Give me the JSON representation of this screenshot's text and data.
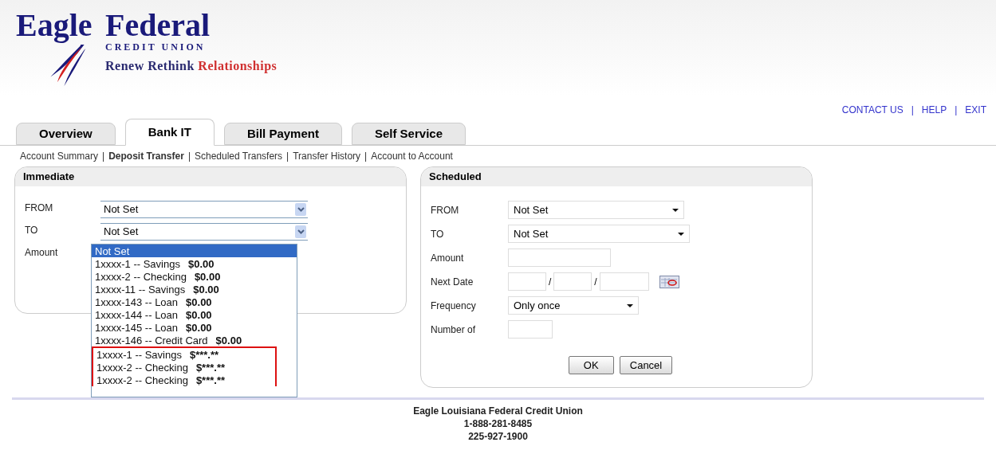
{
  "logo": {
    "word_1": "Eagle",
    "word_2": "Federal",
    "subtitle": "CREDIT UNION",
    "tagline": "Renew Rethink **Relationships**"
  },
  "top_links": [
    "CONTACT US",
    "HELP",
    "EXIT"
  ],
  "top_link_separators": [
    "|",
    "|"
  ],
  "tabs": [
    {
      "label": "Overview",
      "selected": false
    },
    {
      "label": "Bank IT",
      "selected": true
    },
    {
      "label": "Bill Payment",
      "selected": false
    },
    {
      "label": "Self Service",
      "selected": false
    }
  ],
  "subnav": [
    {
      "label": "Account Summary",
      "selected": false
    },
    {
      "label": "Deposit Transfer",
      "selected": true
    },
    {
      "label": "Scheduled Transfers",
      "selected": false
    },
    {
      "label": "Transfer History",
      "selected": false
    },
    {
      "label": "Account to Account",
      "selected": false
    }
  ],
  "subnav_separators": [
    "|",
    "|",
    "|",
    "|"
  ],
  "immediate": {
    "title": "Immediate",
    "from_label": "FROM",
    "from_value": "Not Set",
    "to_label": "TO",
    "to_value": "Not Set",
    "amount_label": "Amount",
    "dropdown": [
      {
        "label": "Not Set",
        "selected": true,
        "highlighted": false
      },
      {
        "label": "1xxxx-1 -- Savings",
        "balance": "$0.00",
        "selected": false,
        "highlighted": false
      },
      {
        "label": "1xxxx-2 -- Checking",
        "balance": "$0.00",
        "selected": false,
        "highlighted": false
      },
      {
        "label": "1xxxx-11 -- Savings",
        "balance": "$0.00",
        "selected": false,
        "highlighted": false
      },
      {
        "label": "1xxxx-143 -- Loan",
        "balance": "$0.00",
        "selected": false,
        "highlighted": false
      },
      {
        "label": "1xxxx-144 -- Loan",
        "balance": "$0.00",
        "selected": false,
        "highlighted": false
      },
      {
        "label": "1xxxx-145 -- Loan",
        "balance": "$0.00",
        "selected": false,
        "highlighted": false
      },
      {
        "label": "1xxxx-146 -- Credit Card",
        "balance": "$0.00",
        "selected": false,
        "highlighted": false
      },
      {
        "label": "1xxxx-1 -- Savings",
        "balance": "$***.**",
        "selected": false,
        "highlighted": true
      },
      {
        "label": "1xxxx-2 -- Checking",
        "balance": "$***.**",
        "selected": false,
        "highlighted": true
      },
      {
        "label": "1xxxx-2 -- Checking",
        "balance": "$***.**",
        "selected": false,
        "highlighted": true
      }
    ]
  },
  "scheduled": {
    "title": "Scheduled",
    "from_label": "FROM",
    "from_value": "Not Set",
    "to_label": "TO",
    "to_value": "Not Set",
    "amount_label": "Amount",
    "date_label": "Next Date",
    "date_separators": [
      "/",
      "/"
    ],
    "frequency_label": "Frequency",
    "frequency_value": "Only once",
    "number_label": "Number of",
    "buttons": [
      "OK",
      "Cancel"
    ]
  },
  "footer": [
    "Eagle Louisiana Federal Credit Union",
    "1-888-281-8485",
    "225-927-1900"
  ]
}
